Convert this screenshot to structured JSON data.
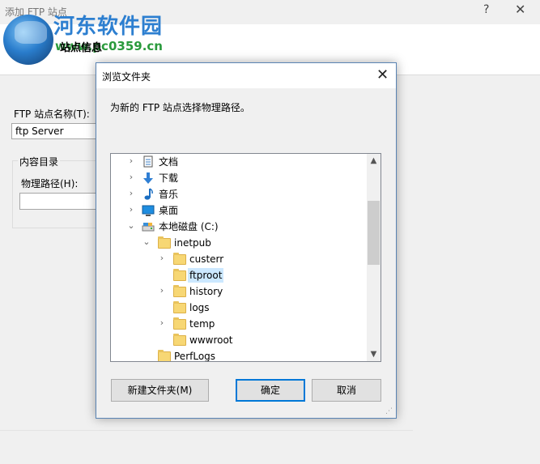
{
  "background_window": {
    "title": "添加 FTP 站点",
    "help": "?",
    "close": "✕",
    "tab_label": "站点信息",
    "site_name_label": "FTP 站点名称(T):",
    "site_name_value": "ftp Server",
    "content_group_label": "内容目录",
    "physical_path_label": "物理路径(H):",
    "physical_path_value": ""
  },
  "watermark": {
    "brand": "河东软件园",
    "url": "www.pc0359.cn"
  },
  "dialog": {
    "title": "浏览文件夹",
    "close": "✕",
    "description": "为新的 FTP 站点选择物理路径。",
    "tree": [
      {
        "label": "文档",
        "icon": "documents-icon",
        "expander": "›",
        "selected": false
      },
      {
        "label": "下载",
        "icon": "downloads-icon",
        "expander": "›",
        "selected": false
      },
      {
        "label": "音乐",
        "icon": "music-icon",
        "expander": "›",
        "selected": false
      },
      {
        "label": "桌面",
        "icon": "desktop-icon",
        "expander": "›",
        "selected": false
      },
      {
        "label": "本地磁盘 (C:)",
        "icon": "drive-icon",
        "expander": "⌄",
        "selected": false
      },
      {
        "label": "inetpub",
        "icon": "folder-icon",
        "expander": "⌄",
        "selected": false
      },
      {
        "label": "custerr",
        "icon": "folder-icon",
        "expander": "›",
        "selected": false
      },
      {
        "label": "ftproot",
        "icon": "folder-icon",
        "expander": "",
        "selected": true
      },
      {
        "label": "history",
        "icon": "folder-icon",
        "expander": "›",
        "selected": false
      },
      {
        "label": "logs",
        "icon": "folder-icon",
        "expander": "",
        "selected": false
      },
      {
        "label": "temp",
        "icon": "folder-icon",
        "expander": "›",
        "selected": false
      },
      {
        "label": "wwwroot",
        "icon": "folder-icon",
        "expander": "",
        "selected": false
      },
      {
        "label": "PerfLogs",
        "icon": "folder-icon",
        "expander": "",
        "selected": false
      }
    ],
    "scroll_up": "▲",
    "scroll_down": "▼",
    "buttons": {
      "new_folder": "新建文件夹(M)",
      "ok": "确定",
      "cancel": "取消"
    },
    "resize_grip": "⋰"
  },
  "colors": {
    "selection": "#cce8ff",
    "accent_border": "#0078d7",
    "folder": "#f7d774"
  }
}
